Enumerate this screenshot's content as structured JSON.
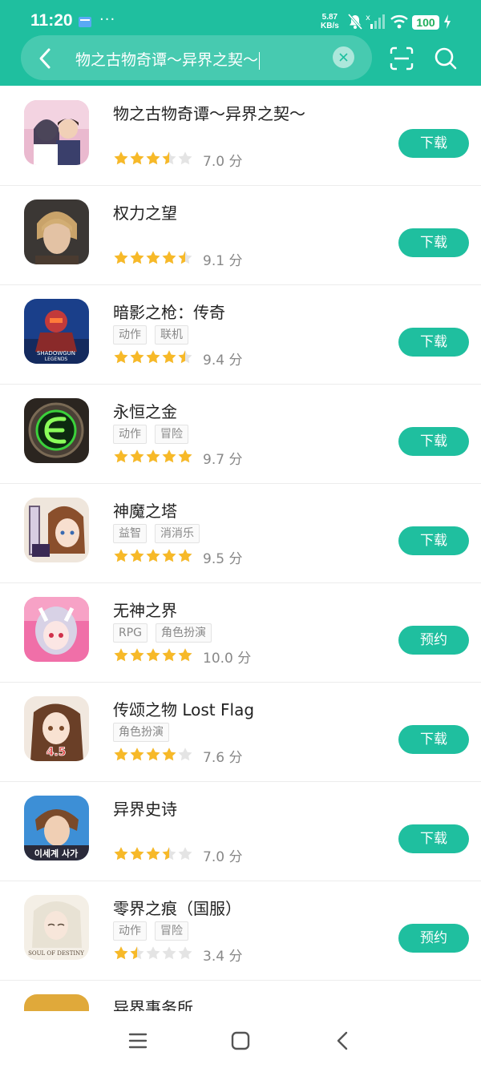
{
  "status_bar": {
    "time": "11:20",
    "dots": "···",
    "net_speed_value": "5.87",
    "net_speed_unit": "KB/s",
    "battery": "100"
  },
  "search": {
    "query": "物之古物奇谭～异界之契～"
  },
  "colors": {
    "accent": "#1fbf9f",
    "star": "#f7b928",
    "star_empty": "#e4e4e4"
  },
  "apps": [
    {
      "name": "物之古物奇谭～异界之契～",
      "tags": [],
      "rating": 3.5,
      "score": "7.0 分",
      "action": "下载"
    },
    {
      "name": "权力之望",
      "tags": [],
      "rating": 4.5,
      "score": "9.1 分",
      "action": "下载"
    },
    {
      "name": "暗影之枪：传奇",
      "tags": [
        "动作",
        "联机"
      ],
      "rating": 4.5,
      "score": "9.4 分",
      "action": "下载"
    },
    {
      "name": "永恒之金",
      "tags": [
        "动作",
        "冒险"
      ],
      "rating": 5,
      "score": "9.7 分",
      "action": "下载"
    },
    {
      "name": "神魔之塔",
      "tags": [
        "益智",
        "消消乐"
      ],
      "rating": 5,
      "score": "9.5 分",
      "action": "下载"
    },
    {
      "name": "无神之界",
      "tags": [
        "RPG",
        "角色扮演"
      ],
      "rating": 5,
      "score": "10.0 分",
      "action": "预约"
    },
    {
      "name": "传颂之物 Lost Flag",
      "tags": [
        "角色扮演"
      ],
      "rating": 4,
      "score": "7.6 分",
      "action": "下载"
    },
    {
      "name": "异界史诗",
      "tags": [],
      "rating": 3.5,
      "score": "7.0 分",
      "action": "下载"
    },
    {
      "name": "零界之痕（国服）",
      "tags": [
        "动作",
        "冒险"
      ],
      "rating": 1.5,
      "score": "3.4 分",
      "action": "预约"
    },
    {
      "name": "异界事务所",
      "tags": [],
      "rating": null,
      "score": "",
      "action": ""
    }
  ]
}
